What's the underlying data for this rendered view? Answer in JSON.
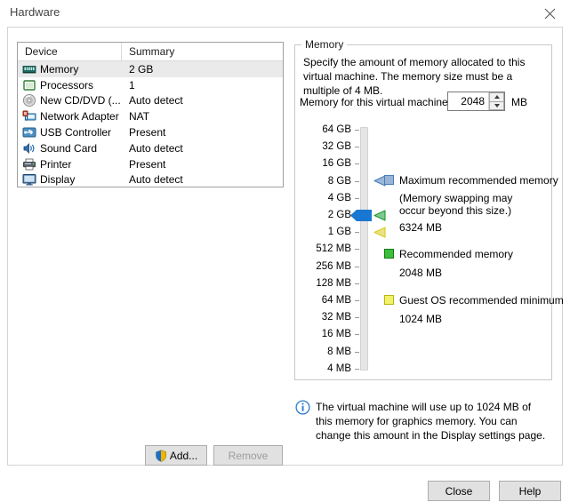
{
  "window": {
    "title": "Hardware",
    "close_icon": "close-icon"
  },
  "device_list": {
    "columns": [
      "Device",
      "Summary"
    ],
    "rows": [
      {
        "icon": "memory-stick-icon",
        "device": "Memory",
        "summary": "2 GB",
        "selected": true
      },
      {
        "icon": "processor-icon",
        "device": "Processors",
        "summary": "1",
        "selected": false
      },
      {
        "icon": "cd-dvd-icon",
        "device": "New CD/DVD (...",
        "summary": "Auto detect",
        "selected": false
      },
      {
        "icon": "network-adapter-icon",
        "device": "Network Adapter",
        "summary": "NAT",
        "selected": false
      },
      {
        "icon": "usb-controller-icon",
        "device": "USB Controller",
        "summary": "Present",
        "selected": false
      },
      {
        "icon": "sound-card-icon",
        "device": "Sound Card",
        "summary": "Auto detect",
        "selected": false
      },
      {
        "icon": "printer-icon",
        "device": "Printer",
        "summary": "Present",
        "selected": false
      },
      {
        "icon": "display-icon",
        "device": "Display",
        "summary": "Auto detect",
        "selected": false
      }
    ]
  },
  "device_buttons": {
    "add_label": "Add...",
    "add_icon": "uac-shield-icon",
    "remove_label": "Remove",
    "remove_enabled": false
  },
  "memory_panel": {
    "group_label": "Memory",
    "description": "Specify the amount of memory allocated to this virtual machine. The memory size must be a multiple of 4 MB.",
    "field_label": "Memory for this virtual machine:",
    "value": "2048",
    "unit": "MB",
    "spinner_up_icon": "chevron-up-icon",
    "spinner_down_icon": "chevron-down-icon"
  },
  "slider": {
    "scale": [
      "64 GB",
      "32 GB",
      "16 GB",
      "8 GB",
      "4 GB",
      "2 GB",
      "1 GB",
      "512 MB",
      "256 MB",
      "128 MB",
      "64 MB",
      "32 MB",
      "16 MB",
      "8 MB",
      "4 MB"
    ],
    "current_position_label": "2 GB",
    "thumb_color": "#1877d2",
    "markers": [
      {
        "name": "maximum-recommended-marker",
        "color": "#4a7ebb",
        "scale_index": 3
      },
      {
        "name": "recommended-marker",
        "color": "#1a9a33",
        "scale_index": 5
      },
      {
        "name": "guest-os-minimum-marker",
        "color": "#d9cc20",
        "scale_index": 6
      }
    ]
  },
  "legend": {
    "maximum": {
      "swatch_color": "#9ab4d4",
      "swatch_border": "#4a7ebb",
      "title": "Maximum recommended memory",
      "note_line1": "(Memory swapping may",
      "note_line2": "occur beyond this size.)",
      "value": "6324 MB"
    },
    "recommended": {
      "swatch_color": "#3bbf3b",
      "swatch_border": "#147a14",
      "title": "Recommended memory",
      "value": "2048 MB"
    },
    "guest_minimum": {
      "swatch_color": "#f2f26a",
      "swatch_border": "#b5b510",
      "title": "Guest OS recommended minimum",
      "value": "1024 MB"
    }
  },
  "note": {
    "icon": "info-icon",
    "text": "The virtual machine will use up to 1024 MB of this memory for graphics memory. You can change this amount in the Display settings page."
  },
  "footer": {
    "close_label": "Close",
    "help_label": "Help"
  }
}
